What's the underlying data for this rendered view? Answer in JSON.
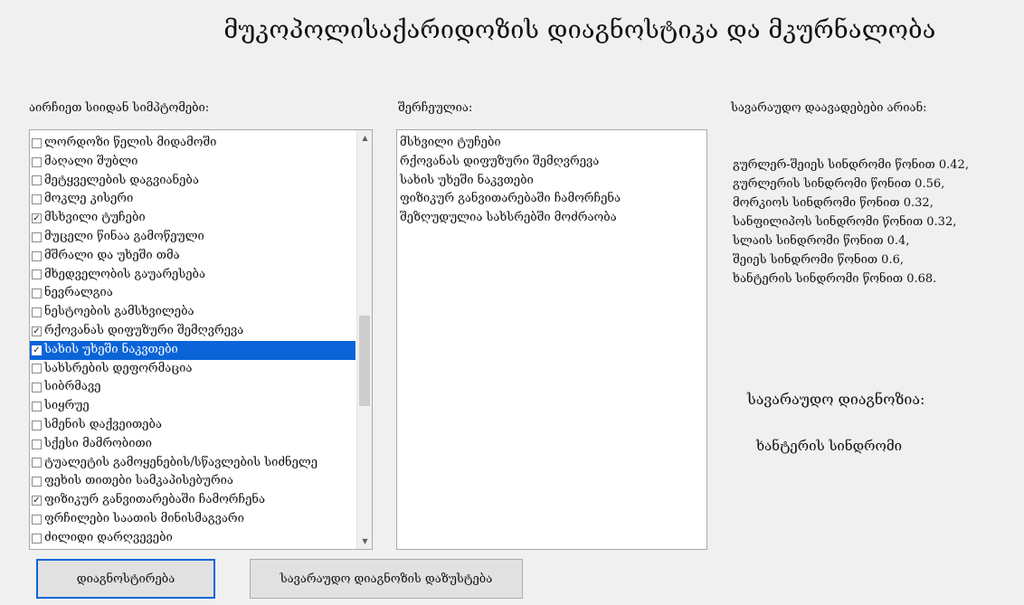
{
  "title": "მუკოპოლისაქარიდოზის დიაგნოსტიკა და მკურნალობა",
  "labels": {
    "symptoms": "აირჩიეთ სიიდან სიმპტომები:",
    "selected": "შერჩეულია:",
    "possible": "სავარაუდო დაავადებები არიან:",
    "likely": "სავარაუდო დიაგნოზია:"
  },
  "symptoms": [
    {
      "label": "ლორდოზი წელის მიდამოში",
      "checked": false,
      "selected": false
    },
    {
      "label": "მაღალი შუბლი",
      "checked": false,
      "selected": false
    },
    {
      "label": "მეტყველების დაგვიანება",
      "checked": false,
      "selected": false
    },
    {
      "label": "მოკლე კისერი",
      "checked": false,
      "selected": false
    },
    {
      "label": "მსხვილი ტუჩები",
      "checked": true,
      "selected": false
    },
    {
      "label": "მუცელი წინაა გამოწეული",
      "checked": false,
      "selected": false
    },
    {
      "label": "მშრალი და უხეში თმა",
      "checked": false,
      "selected": false
    },
    {
      "label": "მხედველობის გაუარესება",
      "checked": false,
      "selected": false
    },
    {
      "label": "ნევრალგია",
      "checked": false,
      "selected": false
    },
    {
      "label": "ნესტოების გამსხვილება",
      "checked": false,
      "selected": false
    },
    {
      "label": "რქოვანას დიფუზური შემღვრევა",
      "checked": true,
      "selected": false
    },
    {
      "label": "სახის უხეში ნაკვთები",
      "checked": true,
      "selected": true
    },
    {
      "label": "სახსრების დეფორმაცია",
      "checked": false,
      "selected": false
    },
    {
      "label": "სიბრმავე",
      "checked": false,
      "selected": false
    },
    {
      "label": "სიყრუე",
      "checked": false,
      "selected": false
    },
    {
      "label": "სმენის დაქვეითება",
      "checked": false,
      "selected": false
    },
    {
      "label": "სქესი მამრობითი",
      "checked": false,
      "selected": false
    },
    {
      "label": "ტუალეტის გამოყენების/სწავლების სიძნელე",
      "checked": false,
      "selected": false
    },
    {
      "label": "ფეხის თითები სამკაპისებურია",
      "checked": false,
      "selected": false
    },
    {
      "label": "ფიზიკურ განვითარებაში ჩამორჩენა",
      "checked": true,
      "selected": false
    },
    {
      "label": "ფრჩილები საათის მინისმაგვარი",
      "checked": false,
      "selected": false
    },
    {
      "label": "ძილიდი დარღვევები",
      "checked": false,
      "selected": false
    }
  ],
  "selected_items": [
    "მსხვილი ტუჩები",
    "რქოვანას დიფუზური შემღვრევა",
    "სახის უხეში ნაკვთები",
    "ფიზიკურ განვითარებაში ჩამორჩენა",
    "შეზღუდულია სახსრებში მოძრაობა"
  ],
  "possible_diseases": [
    "გურლერ-შეიეს სინდრომი წონით 0.42,",
    "გურლერის სინდრომი წონით 0.56,",
    "მორკიოს სინდრომი წონით 0.32,",
    "სანფილიპოს სინდრომი წონით 0.32,",
    "სლაის სინდრომი წონით 0.4,",
    "შეიეს სინდრომი წონით 0.6,",
    "ხანტერის სინდრომი წონით 0.68."
  ],
  "likely_diagnosis": "ხანტერის სინდრომი",
  "buttons": {
    "diagnose": "დიაგნოსტირება",
    "refine": "სავარაუდო დიაგნოზის დაზუსტება"
  },
  "scrollbar": {
    "up_icon": "▲",
    "down_icon": "▼"
  },
  "colors": {
    "highlight": "#0a64d8"
  }
}
